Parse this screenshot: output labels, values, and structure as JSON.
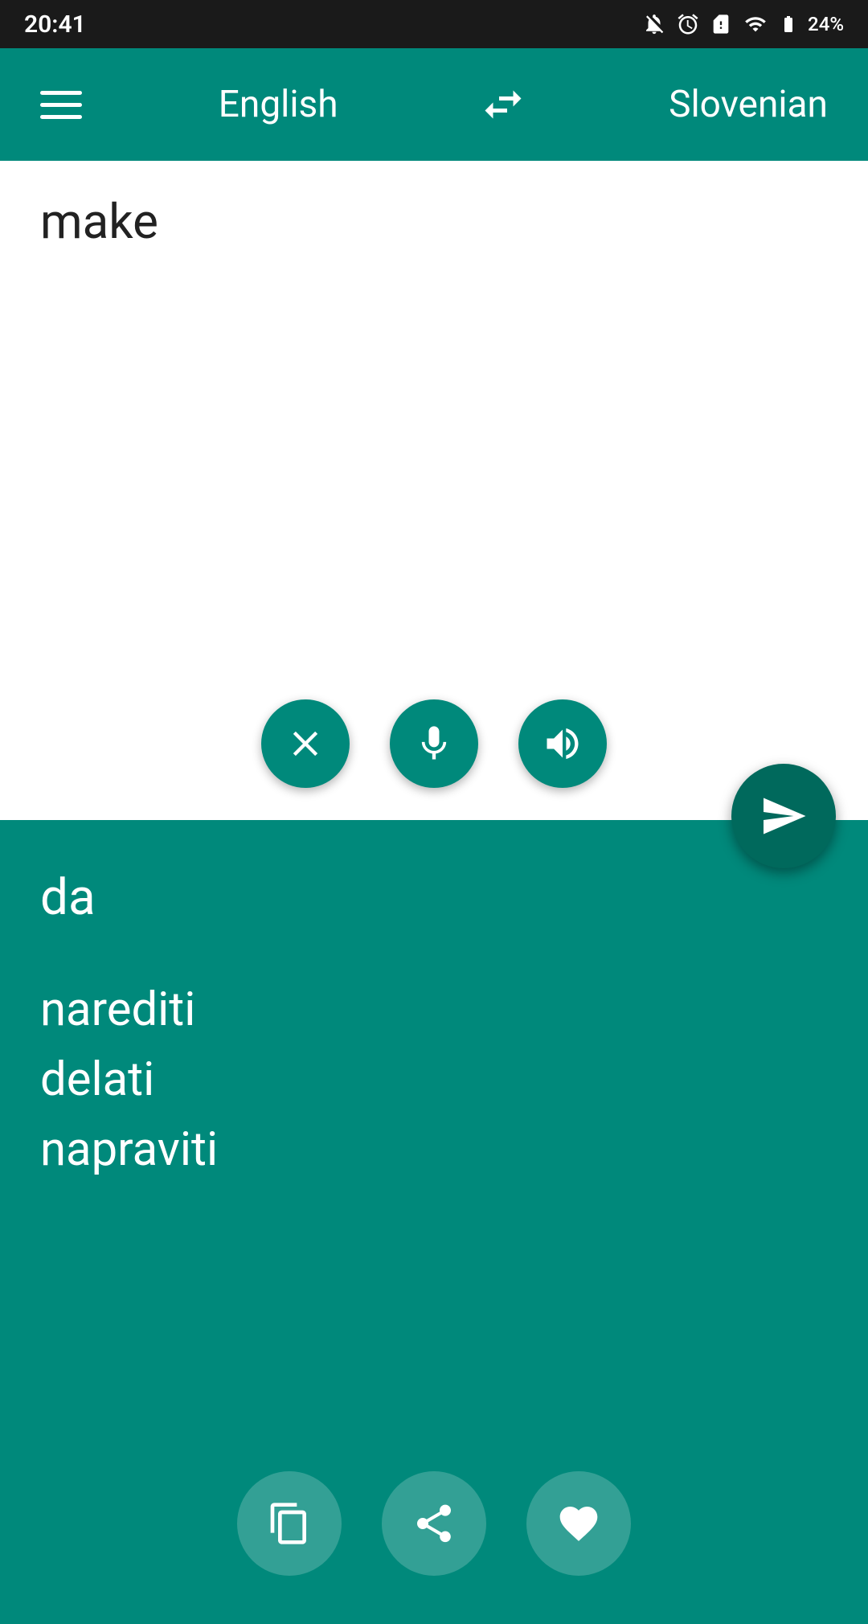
{
  "statusBar": {
    "time": "20:41",
    "battery": "24%"
  },
  "header": {
    "menuLabel": "menu",
    "sourceLang": "English",
    "targetLang": "Slovenian",
    "swapLabel": "swap languages"
  },
  "inputArea": {
    "inputText": "make",
    "clearLabel": "clear",
    "micLabel": "microphone",
    "speakLabel": "speak",
    "translateLabel": "translate"
  },
  "translationArea": {
    "primaryTranslation": "da",
    "secondaryTranslations": [
      "narediti",
      "delati",
      "napraviti"
    ],
    "copyLabel": "copy",
    "shareLabel": "share",
    "favoriteLabel": "favorite"
  }
}
